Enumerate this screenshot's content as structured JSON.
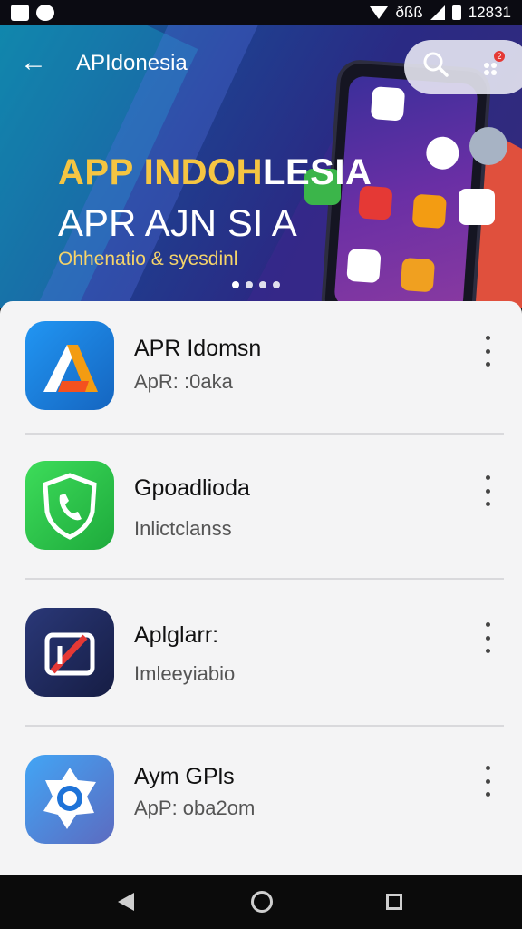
{
  "status_bar": {
    "time": "12831",
    "carrier": "ðßß"
  },
  "header": {
    "title": "APIdonesia"
  },
  "hero": {
    "title_part1": "APP INDOH",
    "title_part2": "LESIA",
    "subtitle": "APR AJN SI  A",
    "tagline": "Ohhenatio & syesdinl",
    "notification_count": "2"
  },
  "apps": [
    {
      "name": "APR Idomsn",
      "subtitle": "ApR: :0aka",
      "icon": "a-logo-icon",
      "color": "#1e88e5"
    },
    {
      "name": "Gpoadlioda",
      "subtitle": "Inlictclanss",
      "icon": "phone-shield-icon",
      "color": "#2ecc40"
    },
    {
      "name": "Aplglarr:",
      "subtitle": "Imleeyiabio",
      "icon": "mirror-icon",
      "color": "#1f2a5a"
    },
    {
      "name": "Aym GPls",
      "subtitle": "ApP: oba2om",
      "icon": "camera-ring-icon",
      "color": "#2196f3"
    }
  ]
}
